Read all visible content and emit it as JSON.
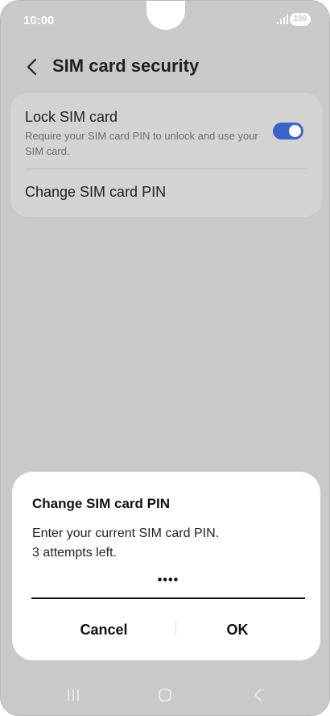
{
  "status_bar": {
    "time": "10:00",
    "battery": "100"
  },
  "header": {
    "title": "SIM card security"
  },
  "settings": {
    "lock_sim": {
      "title": "Lock SIM card",
      "description": "Require your SIM card PIN to unlock and use your SIM card.",
      "enabled": true
    },
    "change_pin_label": "Change SIM card PIN"
  },
  "dialog": {
    "title": "Change SIM card PIN",
    "message_line1": "Enter your current SIM card PIN.",
    "message_line2": "3 attempts left.",
    "pin_value": "••••",
    "cancel_label": "Cancel",
    "ok_label": "OK"
  },
  "colors": {
    "accent": "#3a64c8",
    "dim_background": "#c9c9c9",
    "card": "#d3d3d3"
  },
  "icons": [
    "back-arrow-icon",
    "signal-icon",
    "battery-icon",
    "recents-icon",
    "home-icon",
    "nav-back-icon"
  ]
}
